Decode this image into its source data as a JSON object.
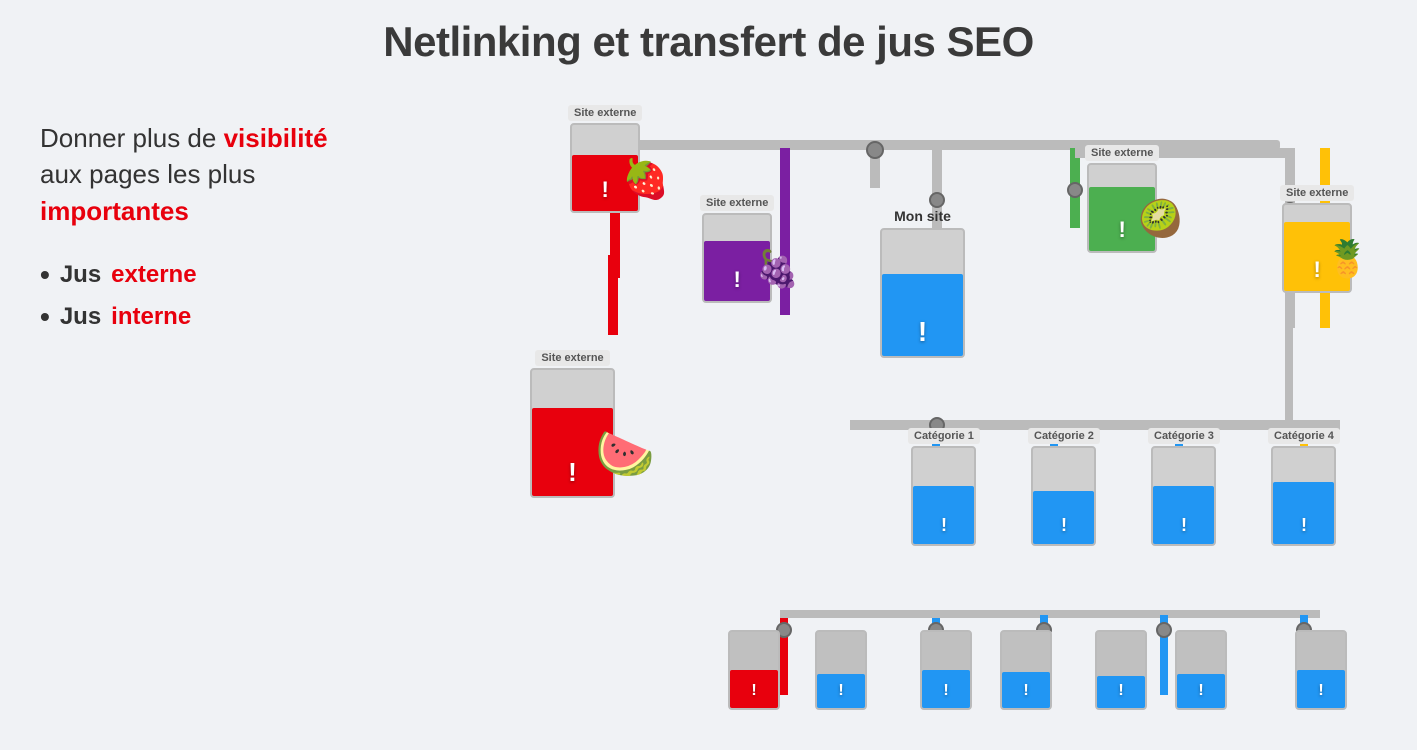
{
  "title": "Netlinking et transfert de jus SEO",
  "left": {
    "desc_part1": "Donner plus de ",
    "desc_highlight1": "visibilité",
    "desc_part2": " aux pages les plus ",
    "desc_highlight2": "importantes",
    "bullets": [
      {
        "text": "Jus ",
        "highlight": "externe"
      },
      {
        "text": "Jus ",
        "highlight": "interne"
      }
    ]
  },
  "diagram": {
    "tanks": {
      "site_externe_top": "Site externe",
      "site_externe_mid": "Site externe",
      "site_externe_left": "Site externe",
      "site_externe_green": "Site externe",
      "site_externe_yellow": "Site externe",
      "mon_site": "Mon site",
      "categorie1": "Catégorie 1",
      "categorie2": "Catégorie 2",
      "categorie3": "Catégorie 3",
      "categorie4": "Catégorie 4"
    }
  }
}
